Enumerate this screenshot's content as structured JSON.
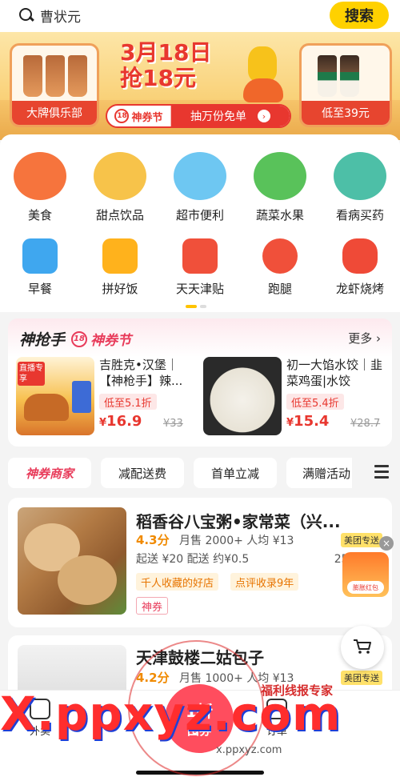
{
  "search": {
    "value": "曹状元",
    "button": "搜索"
  },
  "banner": {
    "title_line1": "3月18日",
    "title_line2": "抢18元",
    "left_brand": "大牌俱乐部",
    "right_brand": "低至39元",
    "fest_badge": "18",
    "fest_label": "神券节",
    "center_text": "抽万份免单",
    "arrow": "›"
  },
  "categories": {
    "row1": [
      {
        "label": "美食",
        "color": "#f6743d"
      },
      {
        "label": "甜点饮品",
        "color": "#f7a6b8"
      },
      {
        "label": "超市便利",
        "color": "#6ec7f2"
      },
      {
        "label": "蔬菜水果",
        "color": "#59c25a"
      },
      {
        "label": "看病买药",
        "color": "#4dbfa7"
      }
    ],
    "row2": [
      {
        "label": "早餐",
        "color": "#3fa7ef"
      },
      {
        "label": "拼好饭",
        "color": "#ffb21c"
      },
      {
        "label": "天天津贴",
        "color": "#f0503a"
      },
      {
        "label": "跑腿",
        "color": "#f0503a"
      },
      {
        "label": "龙虾烧烤",
        "color": "#ef4a37"
      }
    ]
  },
  "deals": {
    "brand": "神抢手",
    "fest_badge": "18",
    "fest_label": "神券节",
    "more": "更多 ›",
    "items": [
      {
        "name": "吉胜克•汉堡｜【神枪手】辣...",
        "discount": "低至5.1折",
        "yen": "¥",
        "price": "16.9",
        "old": "¥33",
        "img_tag": "直播专享"
      },
      {
        "name": "初一大馅水饺｜韭菜鸡蛋|水饺",
        "discount": "低至5.4折",
        "yen": "¥",
        "price": "15.4",
        "old": "¥28.7"
      }
    ]
  },
  "filters": [
    "神券商家",
    "减配送费",
    "首单立减",
    "满赠活动"
  ],
  "shops": [
    {
      "name": "稻香谷八宝粥•家常菜（兴...",
      "score": "4.3分",
      "stats": "月售 2000+  人均 ¥13",
      "delivery": "起送 ¥20  配送 约¥0.5",
      "time": "25 分钟",
      "delivery_tag": "美团专送",
      "badges": [
        "千人收藏的好店",
        "点评收录9年"
      ],
      "coupon": "神券"
    },
    {
      "name": "天津鼓楼二姑包子",
      "score": "4.2分",
      "stats": "月售 1000+  人均 ¥13",
      "delivery_tag": "美团专送"
    }
  ],
  "float_promo": "膨胀红包",
  "close": "×",
  "nav": {
    "left": "外卖",
    "center_big": "1折",
    "center_small": "囤券",
    "right": "订单"
  },
  "watermark": {
    "main": "X.ppxyz.com",
    "top": "福利线报专家",
    "sub": "x.ppxyz.com"
  }
}
